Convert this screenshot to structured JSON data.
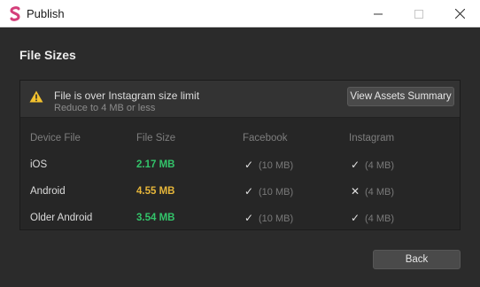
{
  "window": {
    "title": "Publish"
  },
  "heading": "File Sizes",
  "warning": {
    "title": "File is over Instagram size limit",
    "subtitle": "Reduce to 4 MB or less",
    "button_label": "View Assets Summary"
  },
  "table": {
    "headers": [
      "Device File",
      "File Size",
      "Facebook",
      "Instagram"
    ],
    "rows": [
      {
        "device": "iOS",
        "size": "2.17 MB",
        "size_status": "ok",
        "facebook": "(10 MB)",
        "facebook_ok": true,
        "instagram": "(4 MB)",
        "instagram_ok": true
      },
      {
        "device": "Android",
        "size": "4.55 MB",
        "size_status": "warn",
        "facebook": "(10 MB)",
        "facebook_ok": true,
        "instagram": "(4 MB)",
        "instagram_ok": false
      },
      {
        "device": "Older Android",
        "size": "3.54 MB",
        "size_status": "ok",
        "facebook": "(10 MB)",
        "facebook_ok": true,
        "instagram": "(4 MB)",
        "instagram_ok": true
      }
    ]
  },
  "footer": {
    "back_label": "Back"
  },
  "colors": {
    "ok": "#33c46a",
    "warn": "#e6b63a",
    "warning_icon": "#f2c12e",
    "logo": "#d43e7a"
  }
}
